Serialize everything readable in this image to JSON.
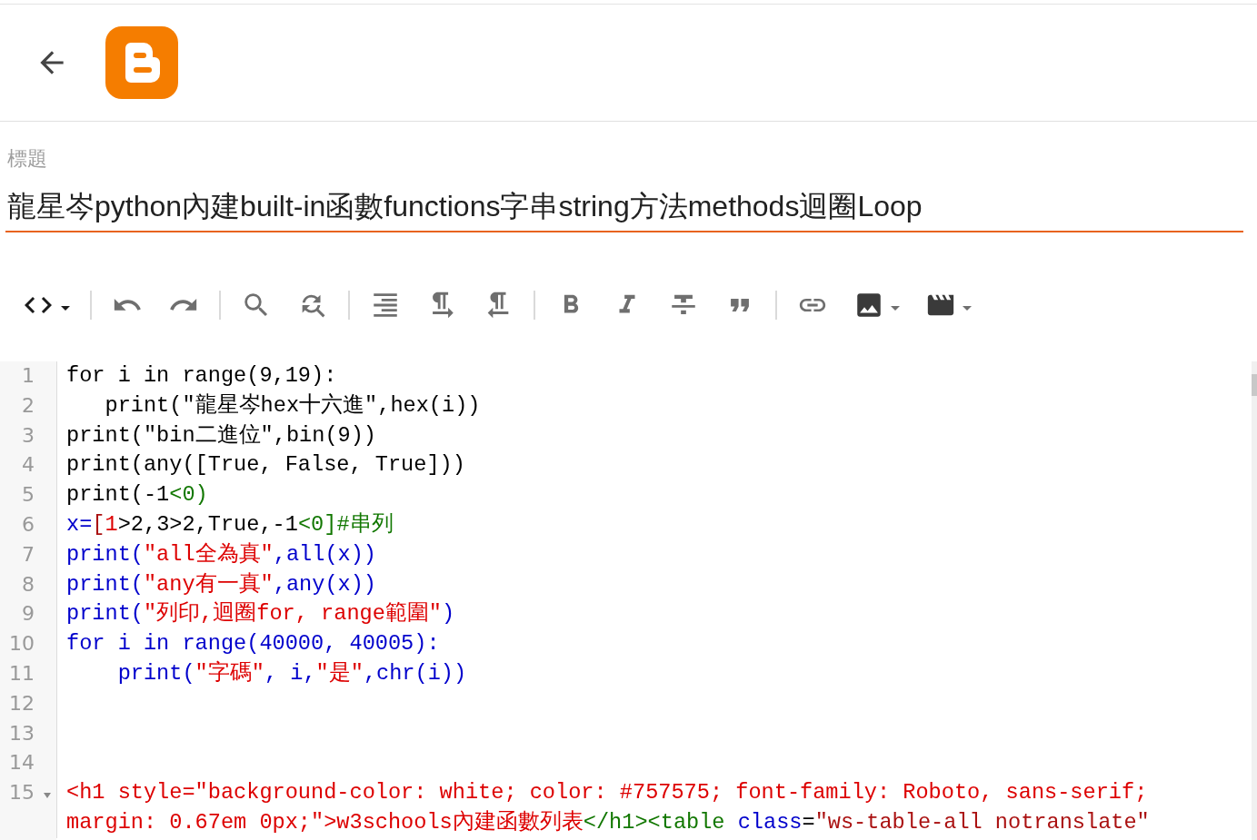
{
  "title_label": "標題",
  "title": "龍星岑python內建built-in函數functions字串string方法methods迴圈Loop",
  "code_lines": [
    {
      "number": "1",
      "foldable": false,
      "tokens": [
        {
          "text": "for i in range(9,19):",
          "color": "#000000"
        }
      ]
    },
    {
      "number": "2",
      "foldable": false,
      "tokens": [
        {
          "text": "   print(\"龍星岑hex十六進\",hex(i))",
          "color": "#000000"
        }
      ]
    },
    {
      "number": "3",
      "foldable": false,
      "tokens": [
        {
          "text": "print(\"bin二進位\",bin(9))",
          "color": "#000000"
        }
      ]
    },
    {
      "number": "4",
      "foldable": false,
      "tokens": [
        {
          "text": "print(any([True, False, True]))",
          "color": "#000000"
        }
      ]
    },
    {
      "number": "5",
      "foldable": false,
      "tokens": [
        {
          "text": "print(-1",
          "color": "#000000"
        },
        {
          "text": "<0)",
          "color": "#117700"
        }
      ]
    },
    {
      "number": "6",
      "foldable": false,
      "tokens": [
        {
          "text": "x=",
          "color": "#0000cc"
        },
        {
          "text": "[",
          "color": "#aa1111"
        },
        {
          "text": "1",
          "color": "#dd0000"
        },
        {
          "text": ">2,3>2,True,-1",
          "color": "#000000"
        },
        {
          "text": "<0]#串列",
          "color": "#117700"
        }
      ]
    },
    {
      "number": "7",
      "foldable": false,
      "tokens": [
        {
          "text": "print(",
          "color": "#0000cc"
        },
        {
          "text": "\"all全為真\"",
          "color": "#dd0000"
        },
        {
          "text": ",all(x))",
          "color": "#0000cc"
        }
      ]
    },
    {
      "number": "8",
      "foldable": false,
      "tokens": [
        {
          "text": "print(",
          "color": "#0000cc"
        },
        {
          "text": "\"any有一真\"",
          "color": "#dd0000"
        },
        {
          "text": ",any(x))",
          "color": "#0000cc"
        }
      ]
    },
    {
      "number": "9",
      "foldable": false,
      "tokens": [
        {
          "text": "print(",
          "color": "#0000cc"
        },
        {
          "text": "\"列印,迴圈for, range範圍\"",
          "color": "#dd0000"
        },
        {
          "text": ")",
          "color": "#0000cc"
        }
      ]
    },
    {
      "number": "10",
      "foldable": false,
      "tokens": [
        {
          "text": "for i in range(40000, 40005):",
          "color": "#0000cc"
        }
      ]
    },
    {
      "number": "11",
      "foldable": false,
      "tokens": [
        {
          "text": "    print(",
          "color": "#0000cc"
        },
        {
          "text": "\"字碼\"",
          "color": "#dd0000"
        },
        {
          "text": ", i,",
          "color": "#0000cc"
        },
        {
          "text": "\"是\"",
          "color": "#dd0000"
        },
        {
          "text": ",chr(i))",
          "color": "#0000cc"
        }
      ]
    },
    {
      "number": "12",
      "foldable": false
    },
    {
      "number": "13",
      "foldable": false
    },
    {
      "number": "14",
      "foldable": false
    },
    {
      "number": "15",
      "foldable": true,
      "tokens": [
        {
          "text": "<h1 style=\"background-color: white; color: #757575; font-family: Roboto, sans-serif; margin: 0.67em 0px;\">w3schools內建函數列表",
          "color": "#dd0000"
        },
        {
          "text": "</h1><table",
          "color": "#117700"
        },
        {
          "text": " class",
          "color": "#0000cc"
        },
        {
          "text": "=",
          "color": "#000000"
        },
        {
          "text": "\"ws-table-all notranslate\"",
          "color": "#aa1111"
        }
      ]
    }
  ]
}
